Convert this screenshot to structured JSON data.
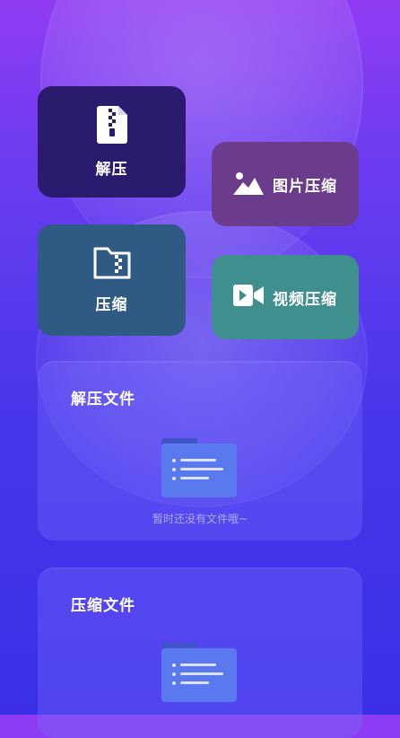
{
  "actions": {
    "decompress": {
      "label": "解压",
      "icon": "zip-file-icon",
      "color": "#2a1b6e"
    },
    "image_compress": {
      "label": "图片压缩",
      "icon": "image-icon",
      "color": "#6b3b8c"
    },
    "compress": {
      "label": "压缩",
      "icon": "folder-zip-icon",
      "color": "#2f5a84"
    },
    "video_compress": {
      "label": "视频压缩",
      "icon": "video-camera-icon",
      "color": "#3e8f8e"
    }
  },
  "sections": {
    "decompressed_files": {
      "title": "解压文件",
      "empty_text": "暂时还没有文件哦~"
    },
    "compressed_files": {
      "title": "压缩文件"
    }
  }
}
